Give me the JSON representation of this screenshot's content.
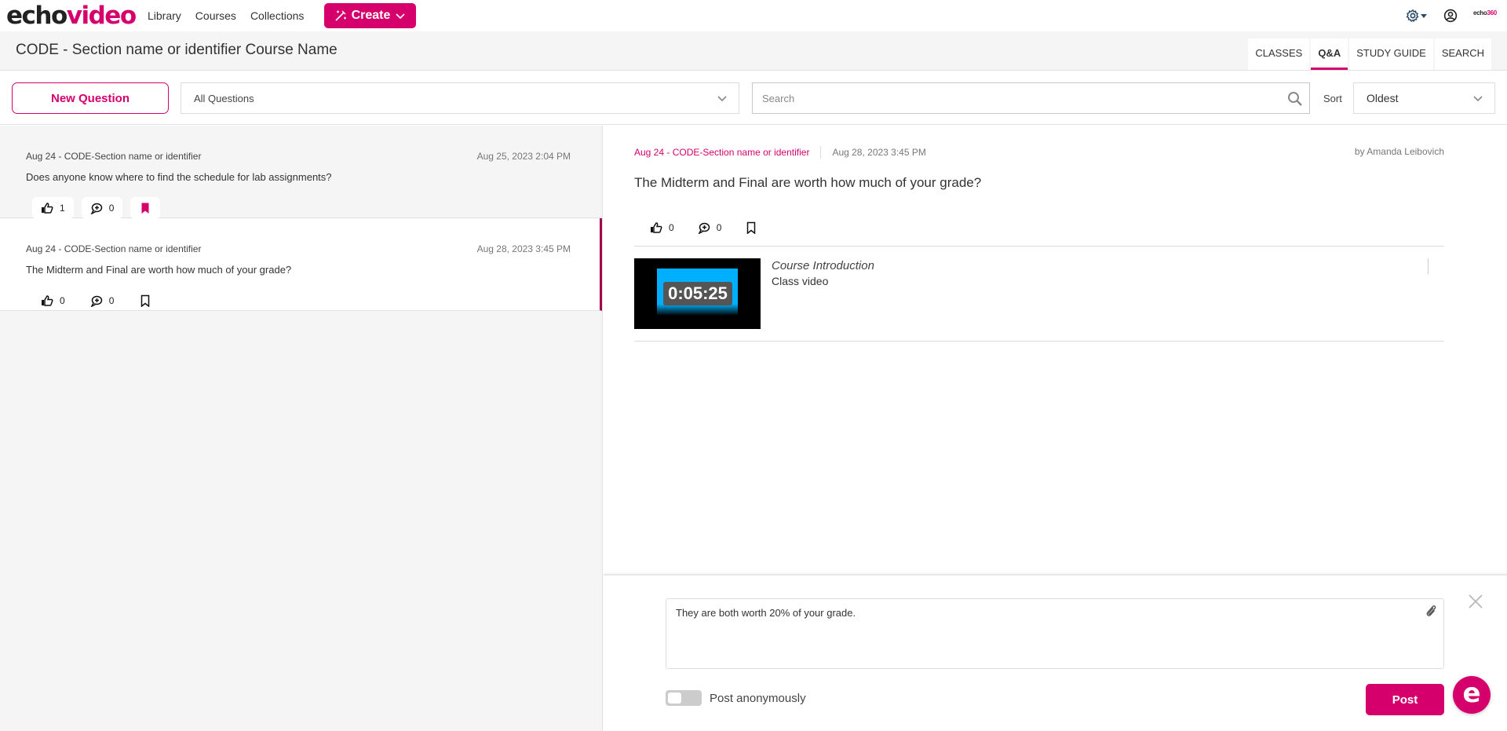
{
  "brand": {
    "echo": "echo",
    "video": "video",
    "small_echo": "echo",
    "small_360": "360"
  },
  "nav": {
    "links": [
      "Library",
      "Courses",
      "Collections"
    ],
    "create_label": "Create"
  },
  "course": {
    "title": "CODE - Section name or identifier Course Name"
  },
  "tabs": [
    {
      "label": "CLASSES",
      "active": false
    },
    {
      "label": "Q&A",
      "active": true
    },
    {
      "label": "STUDY GUIDE",
      "active": false
    },
    {
      "label": "SEARCH",
      "active": false
    }
  ],
  "toolbar": {
    "new_question_label": "New Question",
    "filter_value": "All Questions",
    "search_placeholder": "Search",
    "sort_label": "Sort",
    "sort_value": "Oldest"
  },
  "questions": [
    {
      "course": "Aug 24 - CODE-Section name or identifier",
      "date": "Aug 25, 2023 2:04 PM",
      "text": "Does anyone know where to find the schedule for lab assignments?",
      "likes": "1",
      "replies": "0",
      "bookmarked": true,
      "selected": false
    },
    {
      "course": "Aug 24 - CODE-Section name or identifier",
      "date": "Aug 28, 2023 3:45 PM",
      "text": "The Midterm and Final are worth how much of your grade?",
      "likes": "0",
      "replies": "0",
      "bookmarked": false,
      "selected": true
    }
  ],
  "detail": {
    "course": "Aug 24 - CODE-Section name or identifier",
    "date": "Aug 28, 2023 3:45 PM",
    "author": "by Amanda Leibovich",
    "question": "The Midterm and Final are worth how much of your grade?",
    "likes": "0",
    "replies": "0",
    "media": {
      "timestamp": "0:05:25",
      "title": "Course Introduction",
      "subtitle": "Class video"
    }
  },
  "reply": {
    "text": "They are both worth 20% of your grade.",
    "anonymous_label": "Post anonymously",
    "anonymous": false,
    "post_label": "Post"
  },
  "fab_label": "e",
  "colors": {
    "accent": "#d6006d",
    "selected_border": "#a0004e"
  }
}
